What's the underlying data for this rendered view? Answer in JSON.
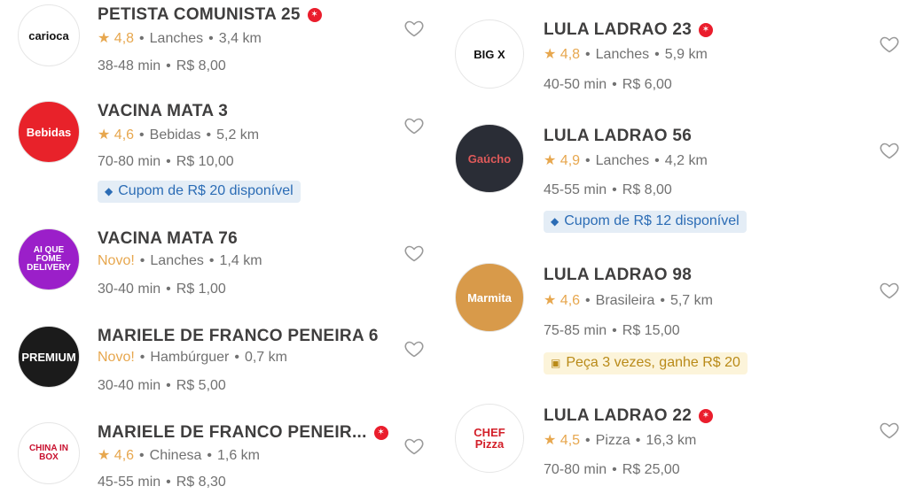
{
  "left": [
    {
      "name": "PETISTA COMUNISTA 25",
      "super": true,
      "rating": "4,8",
      "novo": "",
      "category": "Lanches",
      "distance": "3,4 km",
      "time": "38-48 min",
      "fee": "R$ 8,00",
      "coupon": "",
      "logo_text": "carioca",
      "logo_bg": "#ffffff",
      "logo_fg": "#111111"
    },
    {
      "name": "VACINA MATA 3",
      "super": false,
      "rating": "4,6",
      "novo": "",
      "category": "Bebidas",
      "distance": "5,2 km",
      "time": "70-80 min",
      "fee": "R$ 10,00",
      "coupon": "Cupom de R$ 20 disponível",
      "logo_text": "Bebidas",
      "logo_bg": "#e8222a",
      "logo_fg": "#ffffff"
    },
    {
      "name": "VACINA MATA 76",
      "super": false,
      "rating": "",
      "novo": "Novo!",
      "category": "Lanches",
      "distance": "1,4 km",
      "time": "30-40 min",
      "fee": "R$ 1,00",
      "coupon": "",
      "logo_text": "AI QUE FOME DELIVERY",
      "logo_bg": "#9b1fc9",
      "logo_fg": "#ffffff"
    },
    {
      "name": "MARIELE DE FRANCO PENEIRA 6",
      "super": false,
      "rating": "",
      "novo": "Novo!",
      "category": "Hambúrguer",
      "distance": "0,7 km",
      "time": "30-40 min",
      "fee": "R$ 5,00",
      "coupon": "",
      "logo_text": "PREMIUM",
      "logo_bg": "#1b1b1b",
      "logo_fg": "#ffffff"
    },
    {
      "name": "MARIELE DE FRANCO PENEIR...",
      "super": true,
      "rating": "4,6",
      "novo": "",
      "category": "Chinesa",
      "distance": "1,6 km",
      "time": "45-55 min",
      "fee": "R$ 8,30",
      "coupon": "",
      "logo_text": "CHINA IN BOX",
      "logo_bg": "#ffffff",
      "logo_fg": "#c8102e"
    }
  ],
  "right": [
    {
      "name": "LULA LADRAO 23",
      "super": true,
      "rating": "4,8",
      "novo": "",
      "category": "Lanches",
      "distance": "5,9 km",
      "time": "40-50 min",
      "fee": "R$ 6,00",
      "coupon": "",
      "logo_text": "BIG X",
      "logo_bg": "#ffffff",
      "logo_fg": "#111111"
    },
    {
      "name": "LULA LADRAO 56",
      "super": false,
      "rating": "4,9",
      "novo": "",
      "category": "Lanches",
      "distance": "4,2 km",
      "time": "45-55 min",
      "fee": "R$ 8,00",
      "coupon": "Cupom de R$ 12 disponível",
      "logo_text": "Gaúcho",
      "logo_bg": "#2a2d36",
      "logo_fg": "#e05a5a"
    },
    {
      "name": "LULA LADRAO 98",
      "super": false,
      "rating": "4,6",
      "novo": "",
      "category": "Brasileira",
      "distance": "5,7 km",
      "time": "75-85 min",
      "fee": "R$ 15,00",
      "coupon": "Peça 3 vezes, ganhe R$ 20",
      "logo_text": "Marmita",
      "logo_bg": "#d89a4a",
      "logo_fg": "#ffffff"
    },
    {
      "name": "LULA LADRAO 22",
      "super": true,
      "rating": "4,5",
      "novo": "",
      "category": "Pizza",
      "distance": "16,3 km",
      "time": "70-80 min",
      "fee": "R$ 25,00",
      "coupon": "",
      "logo_text": "CHEF Pizza",
      "logo_bg": "#ffffff",
      "logo_fg": "#d3202a"
    }
  ],
  "icons": {
    "super": "super-restaurant-badge-icon",
    "star": "star-icon",
    "heart": "heart-outline-icon",
    "coupon": "ticket-icon"
  },
  "colors": {
    "accent_red": "#ea1d2c",
    "rating_yellow": "#e7a74e",
    "coupon_blue_bg": "#e4edf6",
    "coupon_blue_text": "#2b6cb5",
    "coupon_yellow_bg": "#fcf4da",
    "coupon_yellow_text": "#b98a18"
  }
}
